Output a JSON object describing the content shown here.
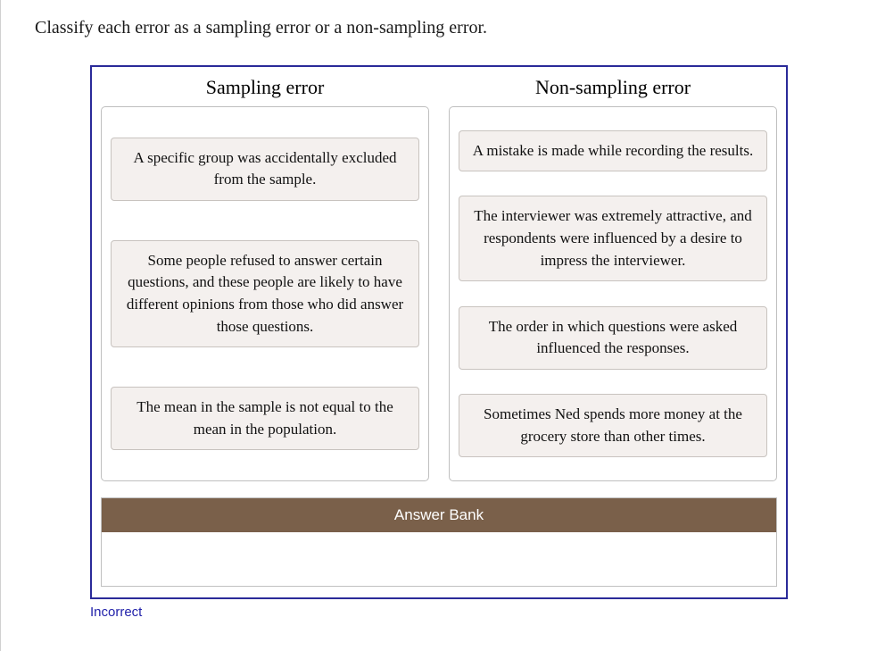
{
  "prompt": "Classify each error as a sampling error or a non-sampling error.",
  "columns": {
    "left": {
      "heading": "Sampling error",
      "cards": [
        "A specific group was accidentally excluded from the sample.",
        "Some people refused to answer certain questions, and these people are likely to have different opinions from those who did answer those questions.",
        "The mean in the sample is not equal to the mean in the population."
      ]
    },
    "right": {
      "heading": "Non-sampling error",
      "cards": [
        "A mistake is made while recording the results.",
        "The interviewer was extremely attractive, and respondents were influenced by a desire to impress the interviewer.",
        "The order in which questions were asked influenced the responses.",
        "Sometimes Ned spends more money at the grocery store than other times."
      ]
    }
  },
  "answer_bank": {
    "title": "Answer Bank"
  },
  "feedback": "Incorrect"
}
